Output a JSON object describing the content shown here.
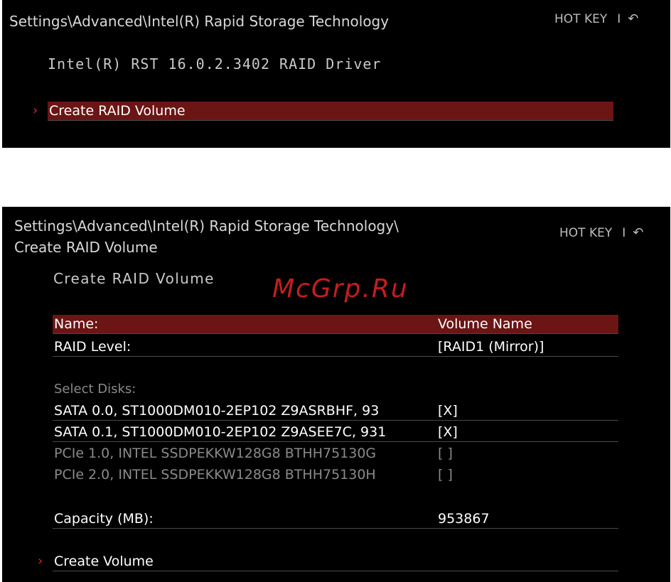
{
  "screen1": {
    "breadcrumb": "Settings\\Advanced\\Intel(R) Rapid Storage Technology",
    "hotkey": {
      "label": "HOT KEY",
      "separator": "I",
      "back_icon": "↶"
    },
    "driver_text": "Intel(R) RST 16.0.2.3402 RAID Driver",
    "menu": [
      {
        "label": "Create RAID Volume",
        "selected": true
      }
    ]
  },
  "screen2": {
    "breadcrumb_line1": "Settings\\Advanced\\Intel(R) Rapid Storage Technology\\",
    "breadcrumb_line2": "Create RAID Volume",
    "hotkey": {
      "label": "HOT KEY",
      "separator": "I",
      "back_icon": "↶"
    },
    "heading": "Create RAID Volume",
    "watermark": "McGrp.Ru",
    "fields": {
      "name": {
        "label": "Name:",
        "value": "Volume Name"
      },
      "raid_level": {
        "label": "RAID Level:",
        "value": "[RAID1 (Mirror)]"
      }
    },
    "select_disks_label": "Select Disks:",
    "disks": [
      {
        "label": "SATA 0.0, ST1000DM010-2EP102 Z9ASRBHF, 93",
        "value": "[X]"
      },
      {
        "label": "SATA 0.1, ST1000DM010-2EP102 Z9ASEE7C, 931",
        "value": "[X]"
      },
      {
        "label": "PCIe 1.0, INTEL SSDPEKKW128G8 BTHH75130G",
        "value": "[ ]"
      },
      {
        "label": "PCIe 2.0, INTEL SSDPEKKW128G8 BTHH75130H",
        "value": "[ ]"
      }
    ],
    "capacity": {
      "label": "Capacity (MB):",
      "value": "953867"
    },
    "create_volume_label": "Create Volume"
  },
  "colors": {
    "background": "#000000",
    "highlight": "#6b1515",
    "accent_arrow": "#d23030",
    "dim_text": "#8a8a8a"
  }
}
